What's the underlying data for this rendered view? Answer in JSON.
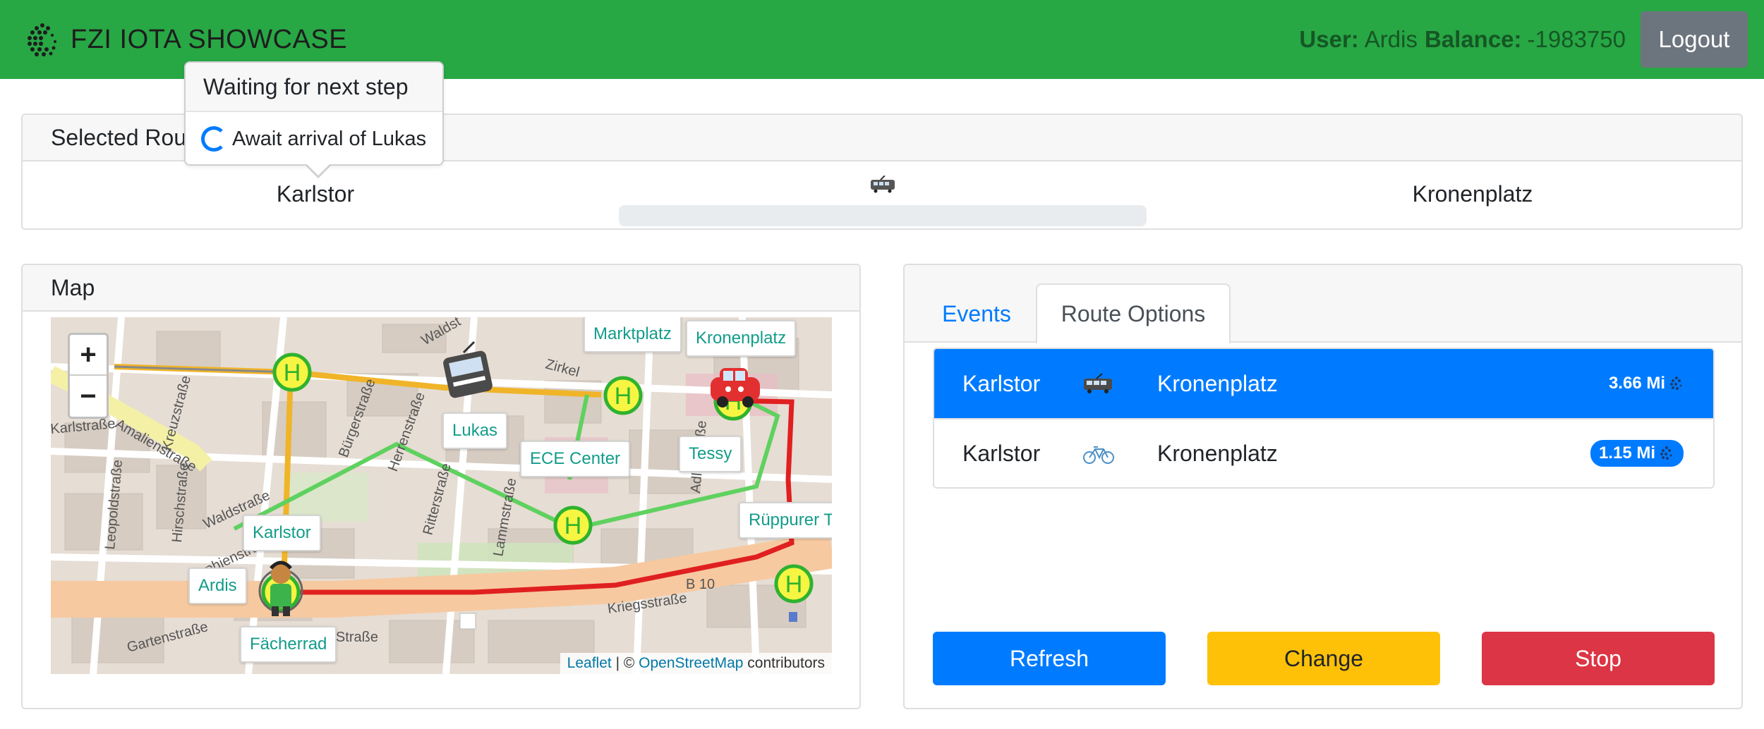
{
  "header": {
    "brand": "FZI IOTA SHOWCASE",
    "user_label": "User:",
    "user_name": "Ardis",
    "balance_label": "Balance:",
    "balance_value": "-1983750",
    "logout_label": "Logout",
    "bg_color": "#28a745"
  },
  "popover": {
    "title": "Waiting for next step",
    "message": "Await arrival of Lukas"
  },
  "selected_route": {
    "header": "Selected Route",
    "from": "Karlstor",
    "to": "Kronenplatz",
    "vehicle_icon": "tram-icon",
    "progress": 0
  },
  "map": {
    "header": "Map",
    "zoom_in": "+",
    "zoom_out": "−",
    "labels": {
      "marktplatz": "Marktplatz",
      "kronenplatz": "Kronenplatz",
      "lukas": "Lukas",
      "ece_center": "ECE Center",
      "tessy": "Tessy",
      "karlstor": "Karlstor",
      "ruppurer": "Rüppurer To",
      "ardis": "Ardis",
      "facherrad": "Fächerrad"
    },
    "streets": [
      "Amalienstraße",
      "Herrenstraße",
      "Zirkel",
      "Kriegsstraße",
      "Ritterstraße",
      "Lammstraße",
      "Adlerstraße",
      "Hirschstraße",
      "Leopoldstraße",
      "Sophienstraße",
      "Waldstraße",
      "Karlstraße",
      "Bürgerstraße",
      "Kreuzstraße",
      "Ettlinger Straße",
      "Gartenstraße",
      "B 10",
      "Waldst"
    ],
    "attribution": {
      "leaflet": "Leaflet",
      "separator": " | © ",
      "osm": "OpenStreetMap",
      "suffix": " contributors"
    }
  },
  "options": {
    "tabs": [
      "Events",
      "Route Options"
    ],
    "active_tab": "Route Options",
    "items": [
      {
        "from": "Karlstor",
        "icon": "tram-icon",
        "to": "Kronenplatz",
        "price": "3.66 Mi",
        "active": true
      },
      {
        "from": "Karlstor",
        "icon": "bicycle-icon",
        "to": "Kronenplatz",
        "price": "1.15 Mi",
        "active": false
      }
    ],
    "buttons": {
      "refresh": "Refresh",
      "change": "Change",
      "stop": "Stop"
    }
  }
}
